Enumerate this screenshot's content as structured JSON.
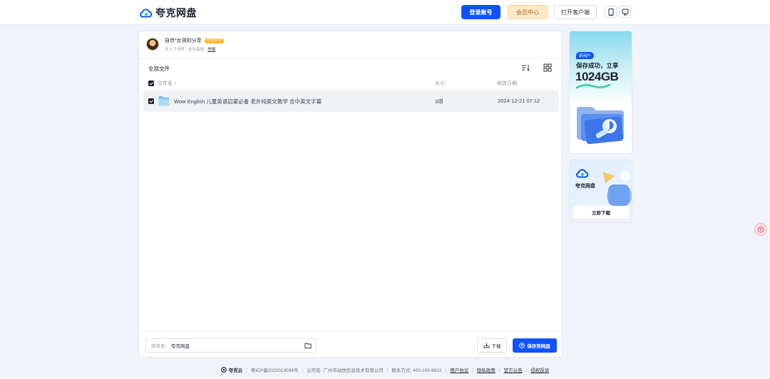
{
  "header": {
    "logo_text": "夸克网盘",
    "login_label": "登录账号",
    "member_label": "会员中心",
    "client_label": "打开客户端",
    "phone_icon": "phone-icon",
    "tv_icon": "tv-icon"
  },
  "share": {
    "sharer_name": "自信*女孩的分享",
    "badge": "夸克SVIP",
    "file_count": "共 1 个文件",
    "validity": "永久有效",
    "report": "举报"
  },
  "files": {
    "section_title": "全部文件",
    "col_name": "文件名 ↑",
    "col_size": "大小",
    "col_date": "修改日期",
    "rows": [
      {
        "name": "Wow English 儿童英语启蒙必备 老外纯英文教学 含中英文字幕",
        "size": "3项",
        "date": "2024-12-21 07:12",
        "type": "folder"
      }
    ]
  },
  "actions": {
    "save_to_label": "转存至：",
    "save_to_value": "夸克网盘",
    "download_label": "下载",
    "save_label": "保存到网盘"
  },
  "promo": {
    "badge": "新用户",
    "line1": "保存成功，立享",
    "line2": "1024GB"
  },
  "app_card": {
    "name": "夸克网盘",
    "download_label": "立即下载"
  },
  "footer": {
    "brand": "夸克云",
    "icp": "粤ICP备2022013084号",
    "company": "公司名: 广州市动悦信息技术有限公司",
    "contact": "联系方式: 400-109-8622",
    "links": [
      "用户协议",
      "隐私政策",
      "官方公告",
      "侵权投诉"
    ]
  },
  "colors": {
    "primary": "#0d53ff",
    "background": "#f0f3f9",
    "member_bg": "#fde9c8"
  }
}
